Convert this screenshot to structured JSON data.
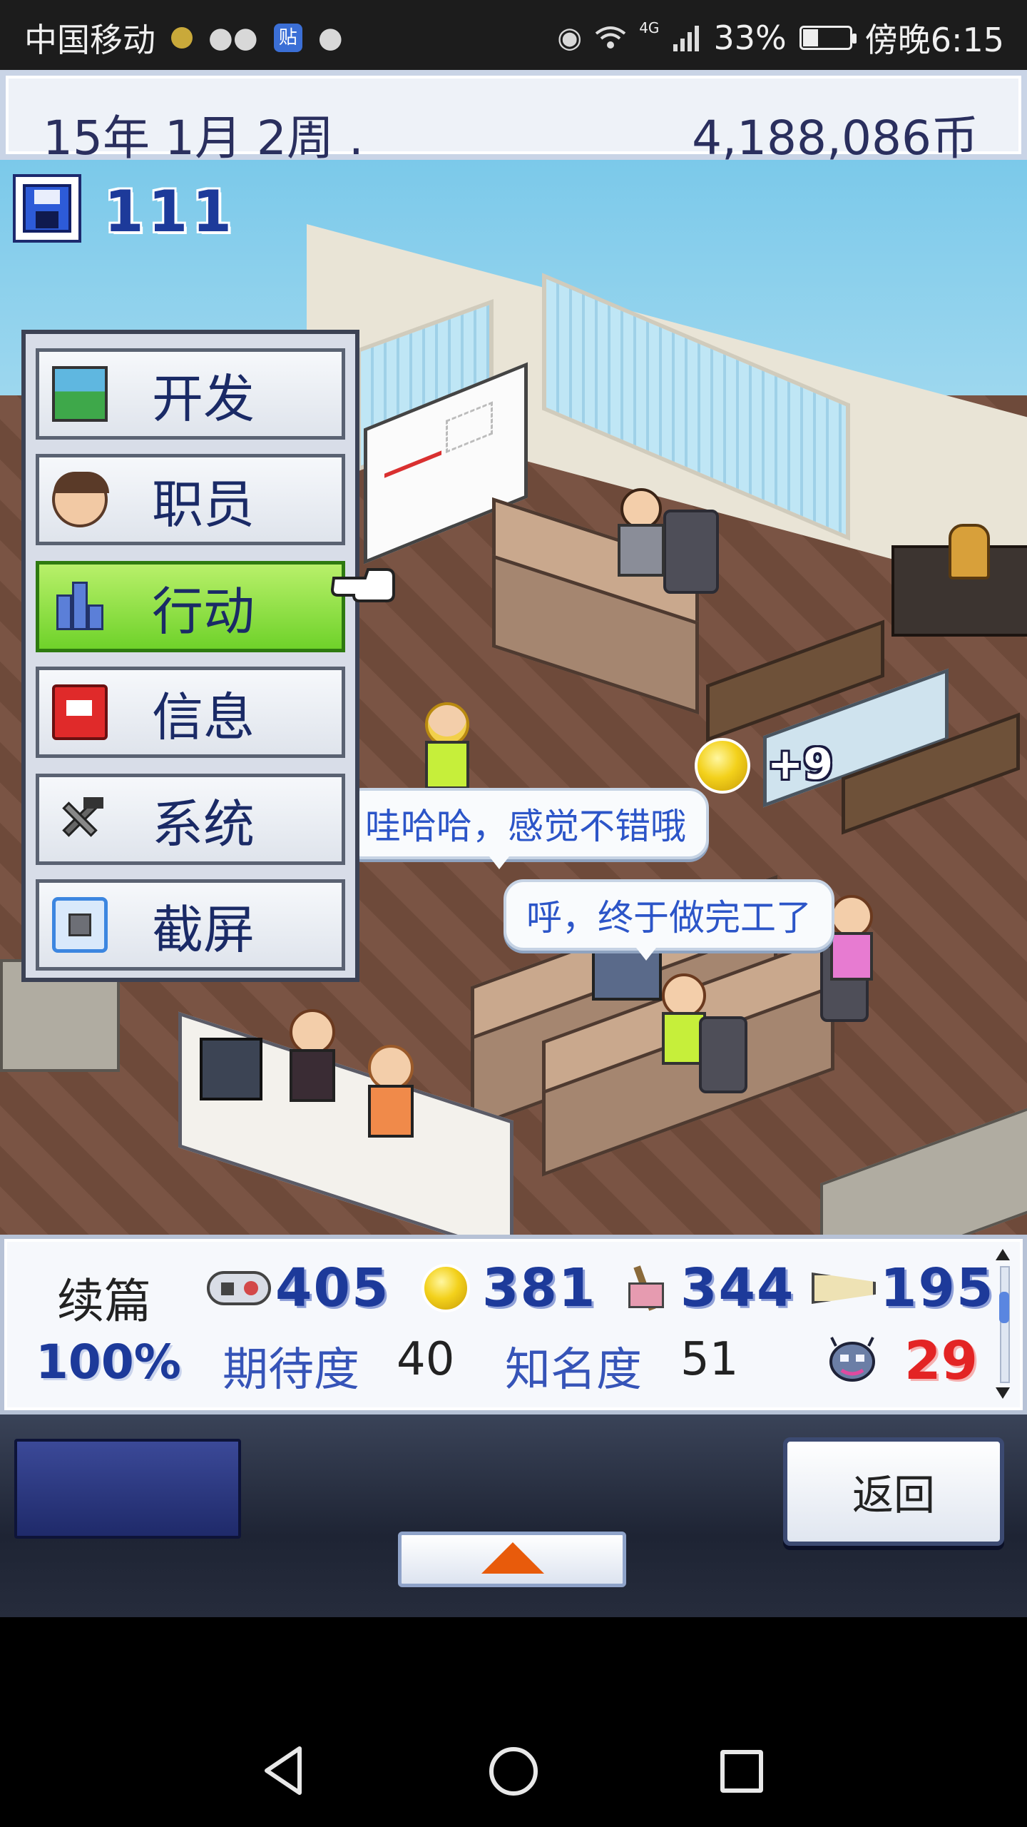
{
  "status_bar": {
    "carrier": "中国移动",
    "network": "4G",
    "battery": "33%",
    "battery_level": 0.33,
    "time": "傍晚6:15",
    "tieba_icon_text": "贴",
    "icons": [
      "notification-dot-icon",
      "wechat-icon",
      "tieba-icon",
      "message-icon",
      "eye-icon",
      "wifi-icon",
      "signal-icon",
      "battery-icon"
    ]
  },
  "top_bar": {
    "date": "15年 1月 2周 .",
    "money": "4,188,086币"
  },
  "save": {
    "count": "111"
  },
  "menu": {
    "items": [
      {
        "label": "开发",
        "icon": "develop-icon"
      },
      {
        "label": "职员",
        "icon": "staff-icon"
      },
      {
        "label": "行动",
        "icon": "action-icon",
        "active": true
      },
      {
        "label": "信息",
        "icon": "info-icon"
      },
      {
        "label": "系统",
        "icon": "system-icon"
      },
      {
        "label": "截屏",
        "icon": "screenshot-icon"
      }
    ]
  },
  "scene": {
    "bubble1": "哇哈哈，感觉不错哦",
    "bubble2": "呼，终于做完工了",
    "coin_gain": "+9"
  },
  "stats": {
    "genre": "续篇",
    "progress": "100%",
    "fun": "405",
    "creativity": "381",
    "graphics": "344",
    "sound": "195",
    "expect_label": "期待度",
    "expect_value": "40",
    "fame_label": "知名度",
    "fame_value": "51",
    "bugs": "29"
  },
  "controls": {
    "back_label": "返回"
  },
  "colors": {
    "accent_active": "#6fd22a",
    "text_blue": "#1d3a9a",
    "bug_red": "#e32424",
    "arrow_orange": "#e85b0b"
  }
}
